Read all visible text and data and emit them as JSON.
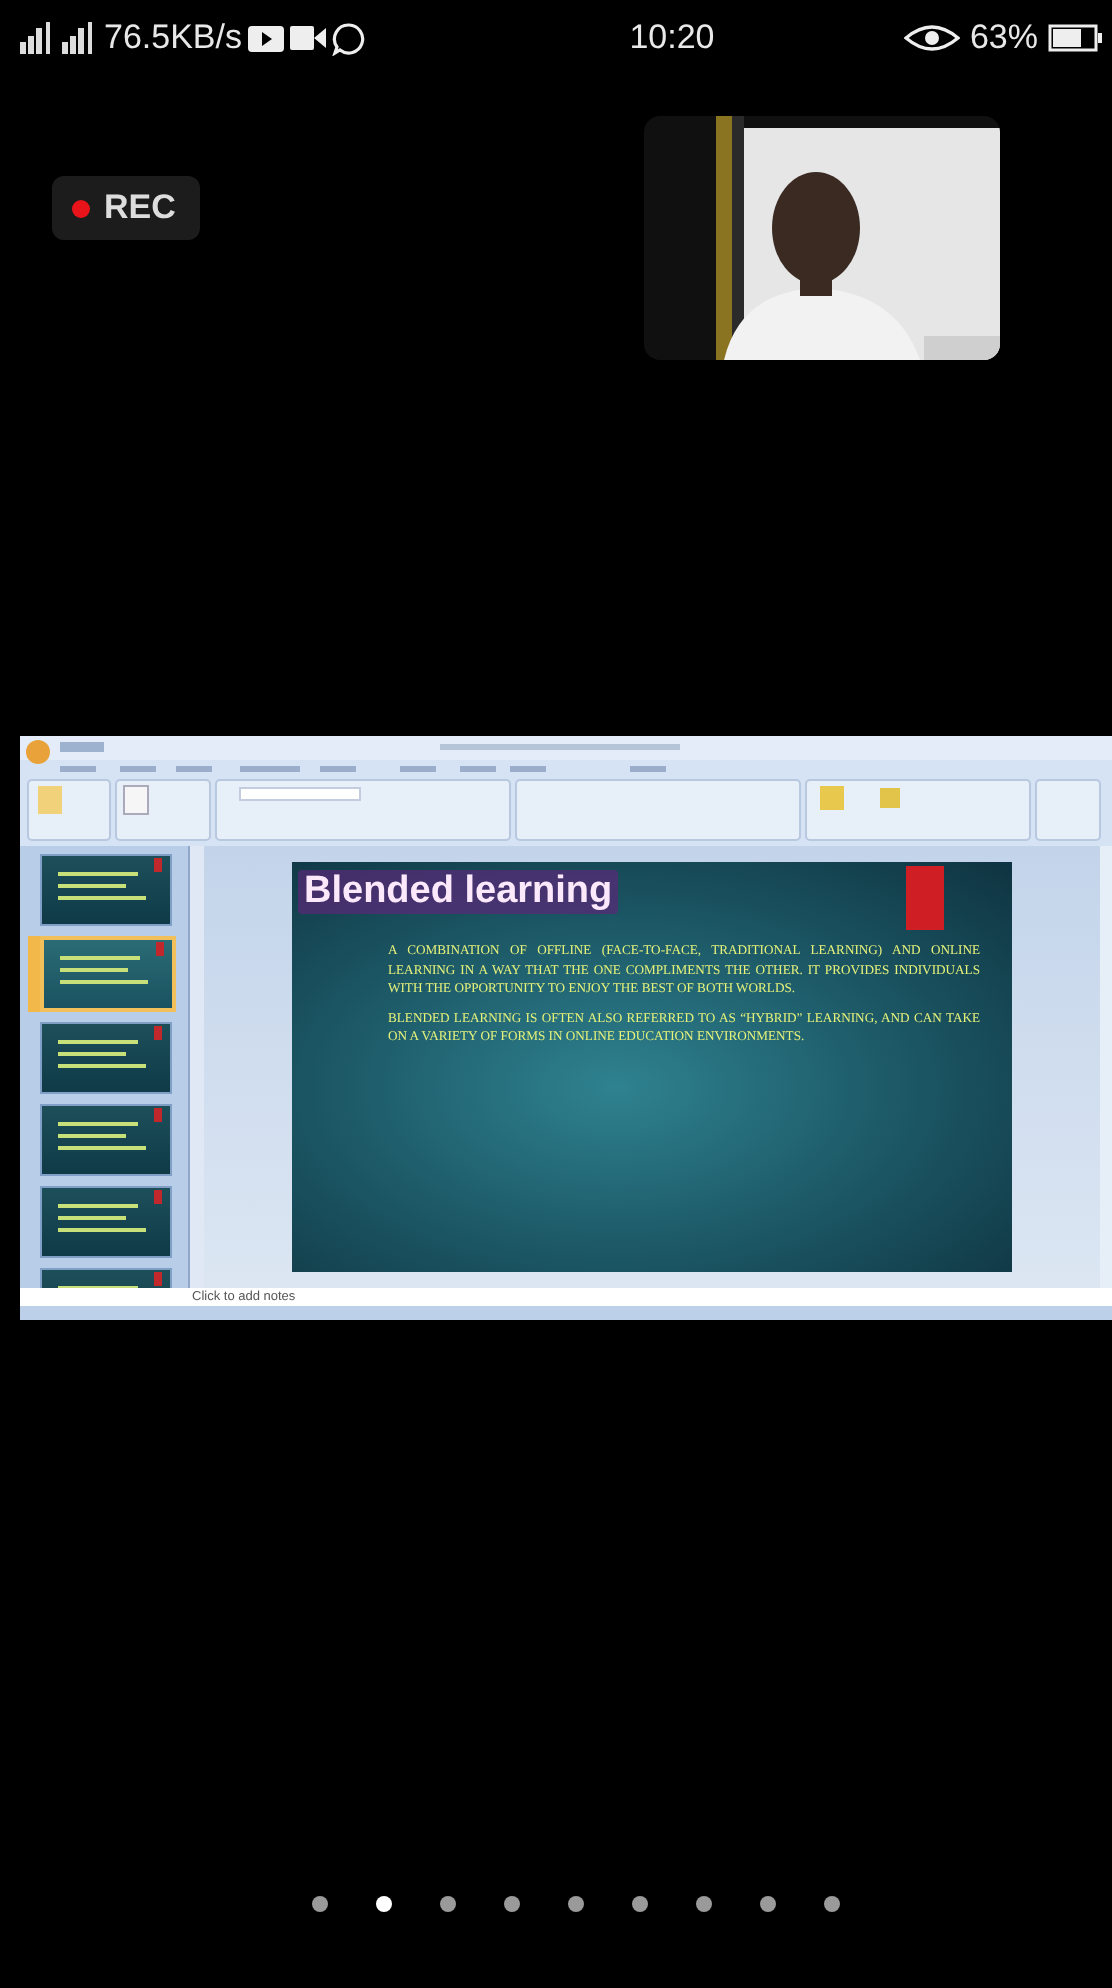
{
  "status_bar": {
    "network_speed": "76.5KB/s",
    "time": "10:20",
    "battery": "63%"
  },
  "recording": {
    "label": "REC"
  },
  "shared_screen": {
    "slide_thumbnails": [
      {
        "selected": false
      },
      {
        "selected": true
      },
      {
        "selected": false
      },
      {
        "selected": false
      },
      {
        "selected": false
      },
      {
        "selected": false
      }
    ],
    "slide": {
      "title": "Blended learning",
      "paragraphs": [
        "A COMBINATION OF OFFLINE (FACE-TO-FACE, TRADITIONAL LEARNING) AND ONLINE LEARNING IN A WAY THAT THE ONE COMPLIMENTS THE OTHER. IT PROVIDES INDIVIDUALS WITH THE OPPORTUNITY TO ENJOY THE BEST OF BOTH WORLDS.",
        "BLENDED LEARNING IS OFTEN ALSO REFERRED TO AS “HYBRID” LEARNING, AND CAN TAKE ON A VARIETY OF FORMS IN ONLINE EDUCATION ENVIRONMENTS."
      ]
    },
    "notes": {
      "placeholder": "Click to add notes"
    }
  },
  "page_dots": [
    {
      "selected": false
    },
    {
      "selected": true
    },
    {
      "selected": false
    },
    {
      "selected": false
    },
    {
      "selected": false
    },
    {
      "selected": false
    },
    {
      "selected": false
    },
    {
      "selected": false
    },
    {
      "selected": false
    }
  ]
}
